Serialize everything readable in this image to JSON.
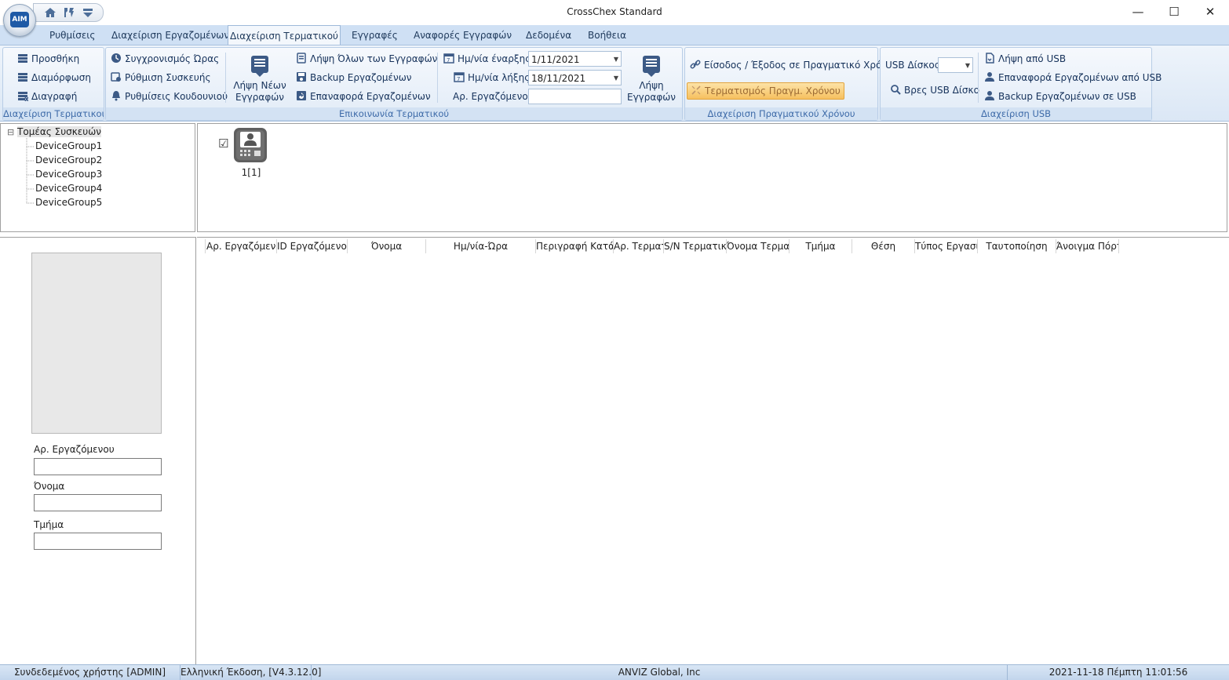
{
  "window": {
    "title": "CrossChex Standard",
    "minimize": "—",
    "maximize": "☐",
    "close": "✕"
  },
  "app": {
    "logo_text": "AIM"
  },
  "tabs": [
    {
      "label": "Ρυθμίσεις"
    },
    {
      "label": "Διαχείριση Εργαζομένων"
    },
    {
      "label": "Διαχείριση Τερματικού"
    },
    {
      "label": "Εγγραφές"
    },
    {
      "label": "Αναφορές Εγγραφών"
    },
    {
      "label": "Δεδομένα"
    },
    {
      "label": "Βοήθεια"
    }
  ],
  "ribbon": {
    "terminal_mgmt": {
      "label": "Διαχείριση Τερματικού",
      "add": "Προσθήκη",
      "configure": "Διαμόρφωση",
      "delete": "Διαγραφή"
    },
    "terminal_comm": {
      "label": "Επικοινωνία Τερματικού",
      "sync_time": "Συγχρονισμός Ώρας",
      "device_settings": "Ρύθμιση Συσκευής",
      "bell_settings": "Ρυθμίσεις Κουδουνιού",
      "get_new_records": "Λήψη Νέων Εγγραφών",
      "get_all_records": "Λήψη Όλων των Εγγραφών",
      "backup_employees": "Backup Εργαζομένων",
      "restore_employees": "Επαναφορά Εργαζομένων",
      "start_date_label": "Ημ/νία έναρξης",
      "start_date_value": "1/11/2021",
      "end_date_label": "Ημ/νία λήξης",
      "end_date_value": "18/11/2021",
      "employee_no_label": "Αρ. Εργαζόμενου",
      "employee_no_value": "",
      "get_records": "Λήψη Εγγραφών"
    },
    "realtime_mgmt": {
      "label": "Διαχείριση Πραγματικού Χρόνου",
      "realtime_io": "Είσοδος / Έξοδος σε Πραγματικό Χρόνο",
      "end_realtime": "Τερματισμός Πραγμ. Χρόνου"
    },
    "usb_mgmt": {
      "label": "Διαχείριση USB",
      "usb_disk_label": "USB Δίσκος",
      "usb_disk_value": "",
      "find_usb": "Βρες USB Δίσκο",
      "get_from_usb": "Λήψη από USB",
      "restore_from_usb": "Επαναφορά Εργαζομένων από USB",
      "backup_to_usb": "Backup Εργαζομένων σε USB"
    }
  },
  "tree": {
    "root": "Τομέας Συσκευών",
    "expander": "⊟",
    "groups": [
      "DeviceGroup1",
      "DeviceGroup2",
      "DeviceGroup3",
      "DeviceGroup4",
      "DeviceGroup5"
    ]
  },
  "device": {
    "checkbox": "☑",
    "label": "1[1]"
  },
  "grid": {
    "columns": [
      "Αρ. Εργαζόμενο",
      "ID Εργαζόμενου",
      "Όνομα",
      "Ημ/νία-Ώρα",
      "Περιγραφή Κατάσ",
      "Αρ. Τερματ",
      "S/N Τερματικο",
      "Όνομα Τερμα",
      "Τμήμα",
      "Θέση",
      "Τύπος Εργασί",
      "Ταυτοποίηση",
      "Άνοιγμα Πόρτ"
    ]
  },
  "employee_panel": {
    "employee_no_label": "Αρ. Εργαζόμενου",
    "employee_no_value": "",
    "name_label": "Όνομα",
    "name_value": "",
    "department_label": "Τμήμα",
    "department_value": ""
  },
  "status": {
    "user": "Συνδεδεμένος χρήστης [ADMIN]",
    "version": "Ελληνική Έκδοση, [V4.3.12.0]",
    "company": "ANVIZ Global, Inc",
    "datetime": "2021-11-18 Πέμπτη 11:01:56"
  },
  "colors": {
    "ribbon_text": "#15315a",
    "group_label": "#3d6aa8",
    "highlight_button": "#f9c86a",
    "tab_bar": "#cfe0f4"
  }
}
